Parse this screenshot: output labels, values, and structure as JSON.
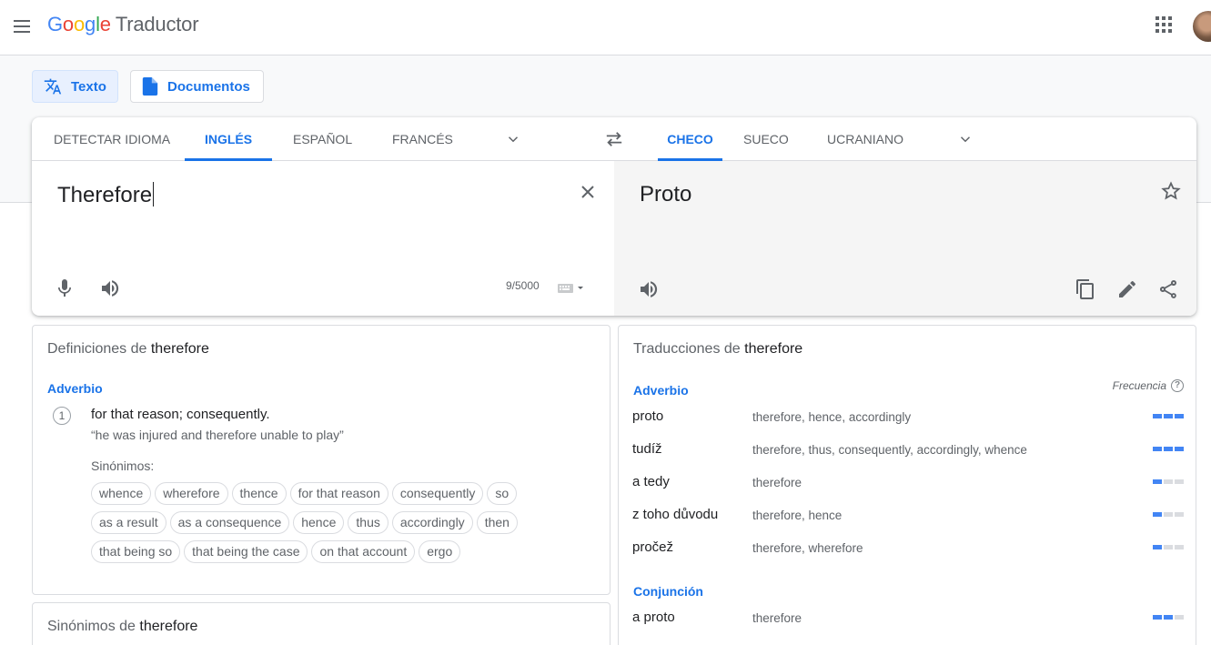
{
  "app": {
    "logo_letters": [
      "G",
      "o",
      "o",
      "g",
      "l",
      "e"
    ],
    "product": "Traductor",
    "menu_icon": "hamburger-icon",
    "apps_icon": "apps-grid-icon",
    "avatar_icon": "user-avatar"
  },
  "modes": [
    {
      "label": "Texto",
      "icon": "translate-icon",
      "active": true
    },
    {
      "label": "Documentos",
      "icon": "document-icon",
      "active": false
    }
  ],
  "source_langs": [
    "DETECTAR IDIOMA",
    "INGLÉS",
    "ESPAÑOL",
    "FRANCÉS"
  ],
  "source_active": "INGLÉS",
  "target_langs": [
    "CHECO",
    "SUECO",
    "UCRANIANO"
  ],
  "target_active": "CHECO",
  "source": {
    "text": "Therefore",
    "char_count": "9/5000"
  },
  "target": {
    "text": "Proto"
  },
  "definitions": {
    "title_prefix": "Definiciones de",
    "word": "therefore",
    "pos": "Adverbio",
    "number": "1",
    "definition": "for that reason; consequently.",
    "example": "“he was injured and therefore unable to play”",
    "synonyms_label": "Sinónimos:",
    "synonym_rows": [
      [
        "whence",
        "wherefore",
        "thence",
        "for that reason",
        "consequently",
        "so"
      ],
      [
        "as a result",
        "as a consequence",
        "hence",
        "thus",
        "accordingly",
        "then"
      ],
      [
        "that being so",
        "that being the case",
        "on that account",
        "ergo"
      ]
    ]
  },
  "synonyms_panel": {
    "title_prefix": "Sinónimos de",
    "word": "therefore"
  },
  "translations": {
    "title_prefix": "Traducciones de",
    "word": "therefore",
    "frequency_label": "Frecuencia",
    "groups": [
      {
        "pos": "Adverbio",
        "rows": [
          {
            "word": "proto",
            "synonyms": "therefore, hence, accordingly",
            "frequency": 3
          },
          {
            "word": "tudíž",
            "synonyms": "therefore, thus, consequently, accordingly, whence",
            "frequency": 3
          },
          {
            "word": "a tedy",
            "synonyms": "therefore",
            "frequency": 1
          },
          {
            "word": "z toho důvodu",
            "synonyms": "therefore, hence",
            "frequency": 1
          },
          {
            "word": "pročež",
            "synonyms": "therefore, wherefore",
            "frequency": 1
          }
        ]
      },
      {
        "pos": "Conjunción",
        "rows": [
          {
            "word": "a proto",
            "synonyms": "therefore",
            "frequency": 2
          }
        ]
      }
    ]
  },
  "colors": {
    "accent": "#1a73e8",
    "frequency_on": "#4285f4",
    "frequency_off": "#dadce0"
  }
}
